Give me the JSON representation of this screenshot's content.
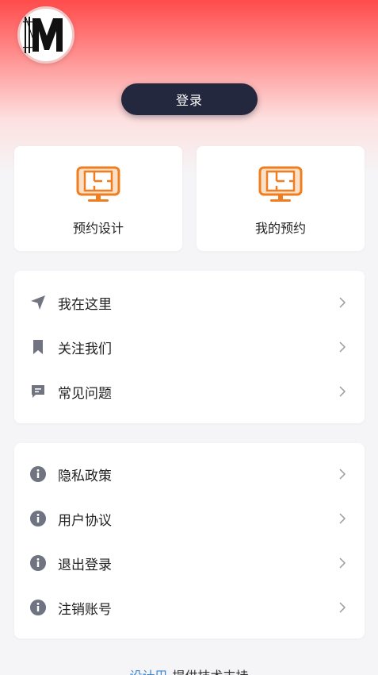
{
  "header": {
    "avatar_letter": "M",
    "login_label": "登录"
  },
  "quick_actions": [
    {
      "label": "预约设计",
      "icon": "floorplan-monitor-icon"
    },
    {
      "label": "我的预约",
      "icon": "floorplan-monitor-icon"
    }
  ],
  "menu_group_1": [
    {
      "label": "我在这里",
      "icon": "location-arrow-icon"
    },
    {
      "label": "关注我们",
      "icon": "bookmark-icon"
    },
    {
      "label": "常见问题",
      "icon": "message-icon"
    }
  ],
  "menu_group_2": [
    {
      "label": "隐私政策",
      "icon": "info-icon"
    },
    {
      "label": "用户协议",
      "icon": "info-icon"
    },
    {
      "label": "退出登录",
      "icon": "info-icon"
    },
    {
      "label": "注销账号",
      "icon": "info-icon"
    }
  ],
  "footer": {
    "brand": "设计巴",
    "text": "提供技术支持"
  },
  "colors": {
    "accent_red": "#ff4b4b",
    "login_bg": "#23283f",
    "icon_orange": "#ef7d21",
    "icon_gray": "#6f7480",
    "brand_blue": "#3a86d6"
  }
}
